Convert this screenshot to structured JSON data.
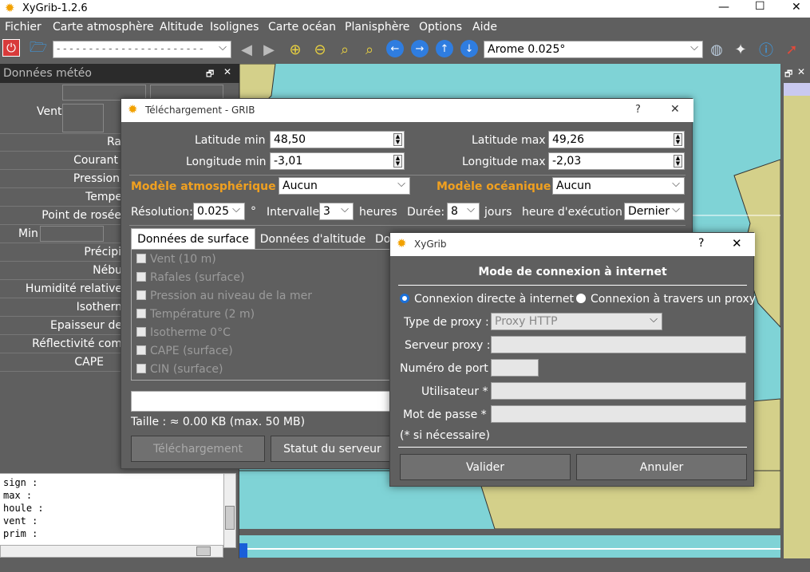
{
  "window": {
    "title": "XyGrib-1.2.6",
    "controls": {
      "minimize": "—",
      "maximize": "☐",
      "close": "✕"
    }
  },
  "menu": [
    "Fichier",
    "Carte atmosphère",
    "Altitude",
    "Isolignes",
    "Carte océan",
    "Planisphère",
    "Options",
    "Aide"
  ],
  "toolbar": {
    "date_combo": "- - - - - - - - - - - - - - - - - - - - - - -",
    "model_combo": "Arome 0.025°"
  },
  "left_panel": {
    "title": "Données météo",
    "rows": [
      "Ra",
      "Courant",
      "Pression",
      "Tempe",
      "Point de rosée",
      "Précipi",
      "Nébu",
      "Humidité relative",
      "Isothern",
      "Epaisseur de",
      "Réflectivité com",
      "CAPE"
    ],
    "vent": "Vent",
    "min": "Min",
    "console": [
      "sign :",
      "max :",
      "houle :",
      "vent :",
      "prim :"
    ]
  },
  "grib_dialog": {
    "title": "Téléchargement - GRIB",
    "help": "?",
    "close": "✕",
    "lat_min_label": "Latitude min :",
    "lat_min": "48,50",
    "lat_max_label": "Latitude max :",
    "lat_max": "49,26",
    "lon_min_label": "Longitude min :",
    "lon_min": "-3,01",
    "lon_max_label": "Longitude max :",
    "lon_max": "-2,03",
    "atmo_label": "Modèle atmosphérique :",
    "atmo_value": "Aucun",
    "ocean_label": "Modèle océanique :",
    "ocean_value": "Aucun",
    "resolution_label": "Résolution:",
    "resolution": "0.025",
    "degree": "°",
    "interval_label": "Intervalle:",
    "interval": "3",
    "hours": "heures",
    "duration_label": "Durée:",
    "duration": "8",
    "days": "jours",
    "run_label": "heure d'exécution :",
    "run": "Dernier",
    "tabs": [
      "Données de surface",
      "Données d'altitude",
      "Do"
    ],
    "checks": [
      "Vent (10 m)",
      "Rafales (surface)",
      "Pression au niveau de la mer",
      "Température (2 m)",
      "Isotherme 0°C",
      "CAPE (surface)",
      "CIN (surface)"
    ],
    "size": "Taille : ≈ 0.00 KB (max. 50 MB)",
    "download_btn": "Téléchargement",
    "status_btn": "Statut du serveur"
  },
  "proxy_dialog": {
    "title": "XyGrib",
    "help": "?",
    "close": "✕",
    "heading": "Mode de connexion à internet",
    "radio_direct": "Connexion directe à internet",
    "radio_proxy": "Connexion à travers un proxy",
    "proxy_type_label": "Type de proxy :",
    "proxy_type": "Proxy HTTP",
    "server_label": "Serveur proxy :",
    "port_label": "Numéro de port :",
    "user_label": "Utilisateur * :",
    "password_label": "Mot de passe * :",
    "note": "(* si nécessaire)",
    "ok": "Valider",
    "cancel": "Annuler"
  },
  "colors": {
    "accent": "#f0a020",
    "map_sea": "#7fd3d6",
    "map_land": "#d4d08a"
  }
}
